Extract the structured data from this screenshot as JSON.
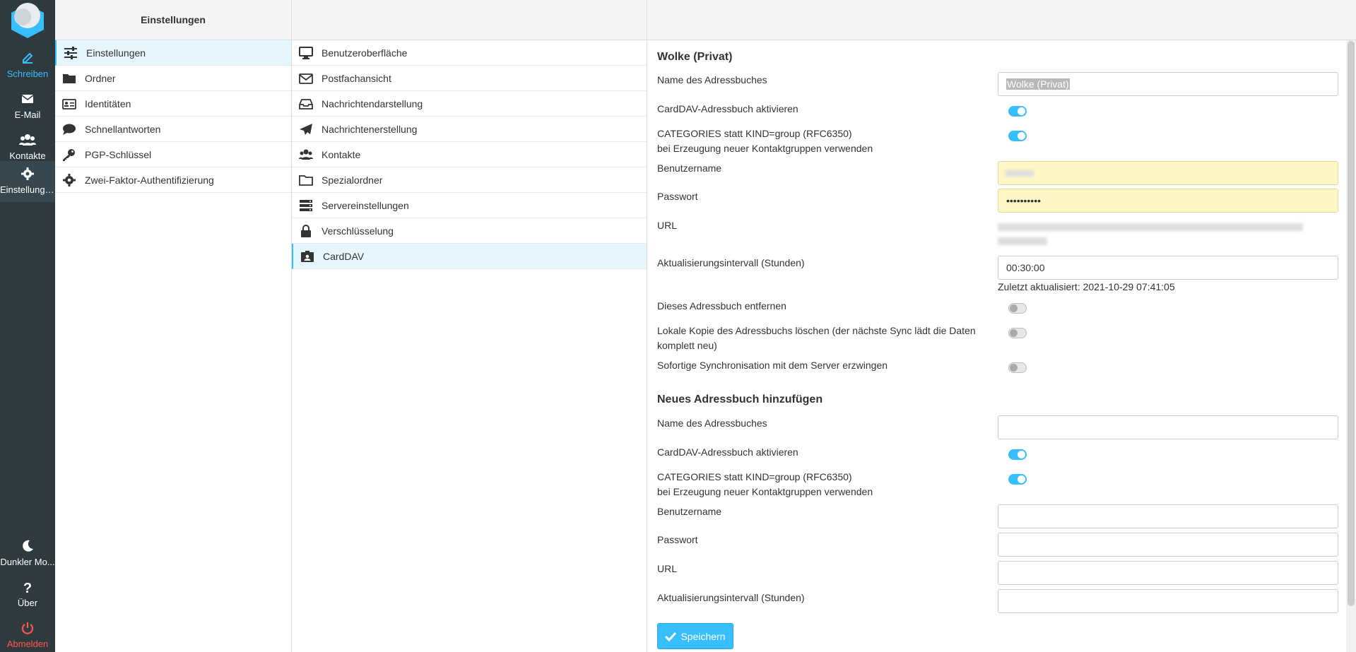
{
  "rail": {
    "compose": "Schreiben",
    "mail": "E-Mail",
    "contacts": "Kontakte",
    "settings": "Einstellungen",
    "darkmode": "Dunkler Mo...",
    "about": "Über",
    "logout": "Abmelden"
  },
  "settings_list": {
    "header": "Einstellungen",
    "items": [
      {
        "label": "Einstellungen",
        "icon": "sliders-icon"
      },
      {
        "label": "Ordner",
        "icon": "folder-icon"
      },
      {
        "label": "Identitäten",
        "icon": "id-card-icon"
      },
      {
        "label": "Schnellantworten",
        "icon": "comment-icon"
      },
      {
        "label": "PGP-Schlüssel",
        "icon": "key-icon"
      },
      {
        "label": "Zwei-Faktor-Authentifizierung",
        "icon": "gear-icon"
      }
    ]
  },
  "sections": {
    "items": [
      {
        "label": "Benutzeroberfläche",
        "icon": "monitor-icon"
      },
      {
        "label": "Postfachansicht",
        "icon": "envelope-icon"
      },
      {
        "label": "Nachrichtendarstellung",
        "icon": "inbox-icon"
      },
      {
        "label": "Nachrichtenerstellung",
        "icon": "paper-plane-icon"
      },
      {
        "label": "Kontakte",
        "icon": "users-icon"
      },
      {
        "label": "Spezialordner",
        "icon": "folder-open-icon"
      },
      {
        "label": "Servereinstellungen",
        "icon": "server-icon"
      },
      {
        "label": "Verschlüsselung",
        "icon": "lock-icon"
      },
      {
        "label": "CardDAV",
        "icon": "address-card-icon"
      }
    ]
  },
  "addressbook": {
    "title": "Wolke (Privat)",
    "name_label": "Name des Adressbuches",
    "name_value": "Wolke (Privat)",
    "activate_label": "CardDAV-Adressbuch aktivieren",
    "activate_on": true,
    "categories_label_1": "CATEGORIES statt KIND=group (RFC6350)",
    "categories_label_2": "bei Erzeugung neuer Kontaktgruppen verwenden",
    "categories_on": true,
    "username_label": "Benutzername",
    "password_label": "Passwort",
    "password_value": "••••••••••",
    "url_label": "URL",
    "interval_label": "Aktualisierungsintervall (Stunden)",
    "interval_value": "00:30:00",
    "last_updated": "Zuletzt aktualisiert: 2021-10-29 07:41:05",
    "remove_label": "Dieses Adressbuch entfernen",
    "clear_label_1": "Lokale Kopie des Adressbuchs löschen (der nächste Sync lädt die Daten",
    "clear_label_2": "komplett neu)",
    "sync_label": "Sofortige Synchronisation mit dem Server erzwingen"
  },
  "new_addressbook": {
    "title": "Neues Adressbuch hinzufügen",
    "name_label": "Name des Adressbuches",
    "activate_label": "CardDAV-Adressbuch aktivieren",
    "categories_label_1": "CATEGORIES statt KIND=group (RFC6350)",
    "categories_label_2": "bei Erzeugung neuer Kontaktgruppen verwenden",
    "username_label": "Benutzername",
    "password_label": "Passwort",
    "url_label": "URL",
    "interval_label": "Aktualisierungsintervall (Stunden)"
  },
  "save_label": "Speichern",
  "colors": {
    "accent": "#37beff",
    "rail_bg": "#2f3a3f",
    "logout": "#ff5552",
    "autofill": "#fff7c6"
  }
}
